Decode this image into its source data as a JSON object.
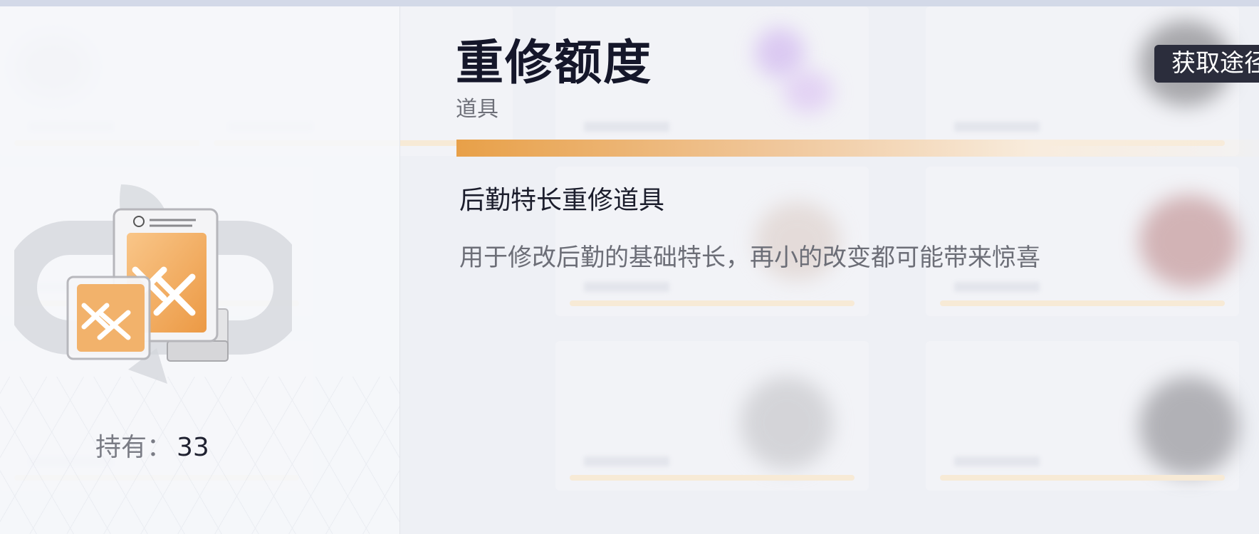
{
  "item": {
    "name": "重修额度",
    "category": "道具",
    "subtitle": "后勤特长重修道具",
    "description": "用于修改后勤的基础特长，再小的改变都可能带来惊喜",
    "owned_label": "持有：",
    "owned_count": "33"
  },
  "actions": {
    "acquire_label": "获取途径"
  },
  "colors": {
    "accent": "#e8a048",
    "button_bg": "#2b2d3c",
    "title": "#15172a"
  },
  "icons": {
    "item_icon": "reroll-ticket-icon"
  }
}
